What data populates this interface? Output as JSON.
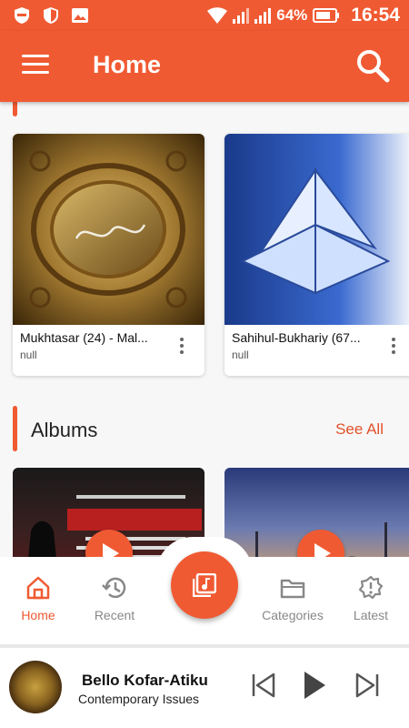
{
  "status_bar": {
    "battery_percent": "64%",
    "time": "16:54",
    "icons": [
      "shield-icon",
      "shield-half-icon",
      "image-icon",
      "wifi-icon",
      "signal-icon",
      "signal-icon",
      "battery-icon"
    ]
  },
  "app_bar": {
    "title": "Home",
    "menu_icon": "menu-icon",
    "search_icon": "search-icon"
  },
  "sections": {
    "top_section_title_cut": "",
    "cards": [
      {
        "title": "Mukhtasar (24) - Mal...",
        "subtitle": "null"
      },
      {
        "title": "Sahihul-Bukhariy (67...",
        "subtitle": "null"
      }
    ],
    "albums": {
      "title": "Albums",
      "see_all": "See All"
    }
  },
  "bottom_nav": {
    "items": [
      {
        "label": "Home",
        "icon": "home-icon",
        "active": true
      },
      {
        "label": "Recent",
        "icon": "history-icon",
        "active": false
      },
      {
        "label": "Categories",
        "icon": "folder-icon",
        "active": false
      },
      {
        "label": "Latest",
        "icon": "alert-badge-icon",
        "active": false
      }
    ],
    "fab_icon": "music-library-icon"
  },
  "player": {
    "title": "Bello Kofar-Atiku",
    "subtitle": "Contemporary Issues",
    "controls": [
      "skip-previous-icon",
      "play-icon",
      "skip-next-icon"
    ]
  },
  "colors": {
    "accent": "#f05a32",
    "text": "#111111",
    "muted": "#888888"
  }
}
